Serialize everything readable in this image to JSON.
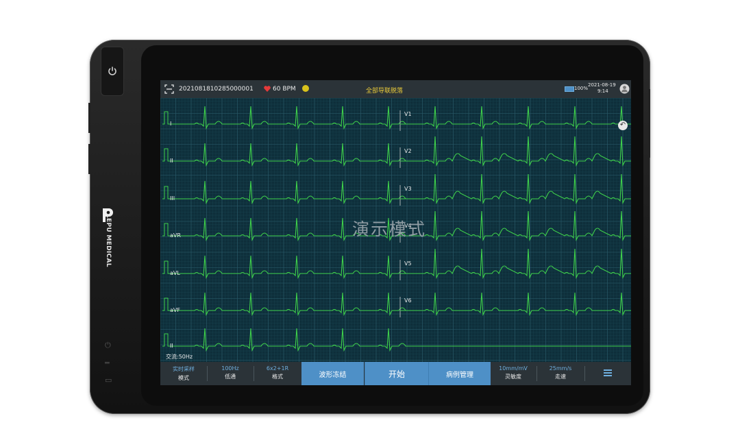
{
  "device": {
    "brand": "LEPU MEDICAL",
    "power_icon": "power-icon"
  },
  "status": {
    "id": "2021081810285000001",
    "heart_rate": "60 BPM",
    "alert": "全部导联脱落",
    "battery": "100%",
    "date": "2021-08-19",
    "time": "9:14"
  },
  "overlay": {
    "demo_mode": "演示模式",
    "filter": "交流:50Hz"
  },
  "leads_left": [
    "I",
    "II",
    "III",
    "aVR",
    "aVL",
    "aVF",
    "II"
  ],
  "leads_right": [
    "V1",
    "V2",
    "V3",
    "V4",
    "V5",
    "V6"
  ],
  "bottom": {
    "mode_value": "实时采样",
    "mode_label": "模式",
    "lowpass_value": "100Hz",
    "lowpass_label": "低通",
    "format_value": "6x2+1R",
    "format_label": "格式",
    "freeze": "波形冻结",
    "start": "开始",
    "records": "病例管理",
    "gain_value": "10mm/mV",
    "gain_label": "灵敏度",
    "speed_value": "25mm/s",
    "speed_label": "走速"
  },
  "colors": {
    "screen_bg": "#0e2f3b",
    "waveform": "#3fd14b",
    "accent_blue": "#4e90c7",
    "heart_red": "#e53a3a",
    "signal_yellow": "#d9c21c",
    "alert_yellow": "#e8c93a"
  }
}
